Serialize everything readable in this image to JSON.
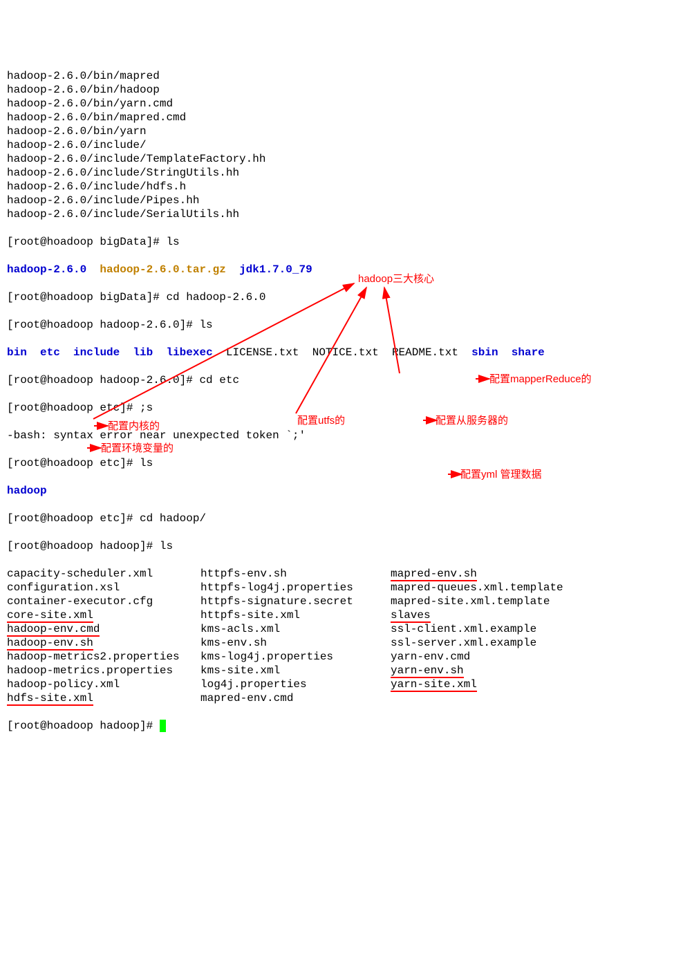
{
  "tar_lines": [
    "hadoop-2.6.0/bin/mapred",
    "hadoop-2.6.0/bin/hadoop",
    "hadoop-2.6.0/bin/yarn.cmd",
    "hadoop-2.6.0/bin/mapred.cmd",
    "hadoop-2.6.0/bin/yarn",
    "hadoop-2.6.0/include/",
    "hadoop-2.6.0/include/TemplateFactory.hh",
    "hadoop-2.6.0/include/StringUtils.hh",
    "hadoop-2.6.0/include/hdfs.h",
    "hadoop-2.6.0/include/Pipes.hh",
    "hadoop-2.6.0/include/SerialUtils.hh"
  ],
  "prompts": {
    "p1": "[root@hoadoop bigData]# ls",
    "p2a": "hadoop-2.6.0",
    "p2b": "hadoop-2.6.0.tar.gz",
    "p2c": "jdk1.7.0_79",
    "p3": "[root@hoadoop bigData]# cd hadoop-2.6.0",
    "p4": "[root@hoadoop hadoop-2.6.0]# ls",
    "p5": "[root@hoadoop hadoop-2.6.0]# cd etc",
    "p6": "[root@hoadoop etc]# ;s",
    "p7": "-bash: syntax error near unexpected token `;'",
    "p8": "[root@hoadoop etc]# ls",
    "p9": "hadoop",
    "p10": "[root@hoadoop etc]# cd hadoop/",
    "p11": "[root@hoadoop hadoop]# ls",
    "p12": "[root@hoadoop hadoop]# "
  },
  "dir_list": {
    "d1": "bin",
    "d2": "etc",
    "d3": "include",
    "d4": "lib",
    "d5": "libexec",
    "f1": "LICENSE.txt",
    "f2": "NOTICE.txt",
    "f3": "README.txt",
    "d6": "sbin",
    "d7": "share"
  },
  "cols": {
    "c1": [
      "capacity-scheduler.xml",
      "configuration.xsl",
      "container-executor.cfg",
      "core-site.xml",
      "hadoop-env.cmd",
      "hadoop-env.sh",
      "hadoop-metrics2.properties",
      "hadoop-metrics.properties",
      "hadoop-policy.xml",
      "hdfs-site.xml"
    ],
    "c2": [
      "httpfs-env.sh",
      "httpfs-log4j.properties",
      "httpfs-signature.secret",
      "httpfs-site.xml",
      "kms-acls.xml",
      "kms-env.sh",
      "kms-log4j.properties",
      "kms-site.xml",
      "log4j.properties",
      "mapred-env.cmd"
    ],
    "c3": [
      "mapred-env.sh",
      "mapred-queues.xml.template",
      "mapred-site.xml.template",
      "slaves",
      "ssl-client.xml.example",
      "ssl-server.xml.example",
      "yarn-env.cmd",
      "yarn-env.sh",
      "yarn-site.xml",
      ""
    ]
  },
  "notes": {
    "title": "hadoop三大核心",
    "core": "配置内核的",
    "env": "配置环境变量的",
    "utfs": "配置utfs的",
    "mapper": "配置mapperReduce的",
    "slaves": "配置从服务器的",
    "yml": "配置yml 管理数据"
  }
}
